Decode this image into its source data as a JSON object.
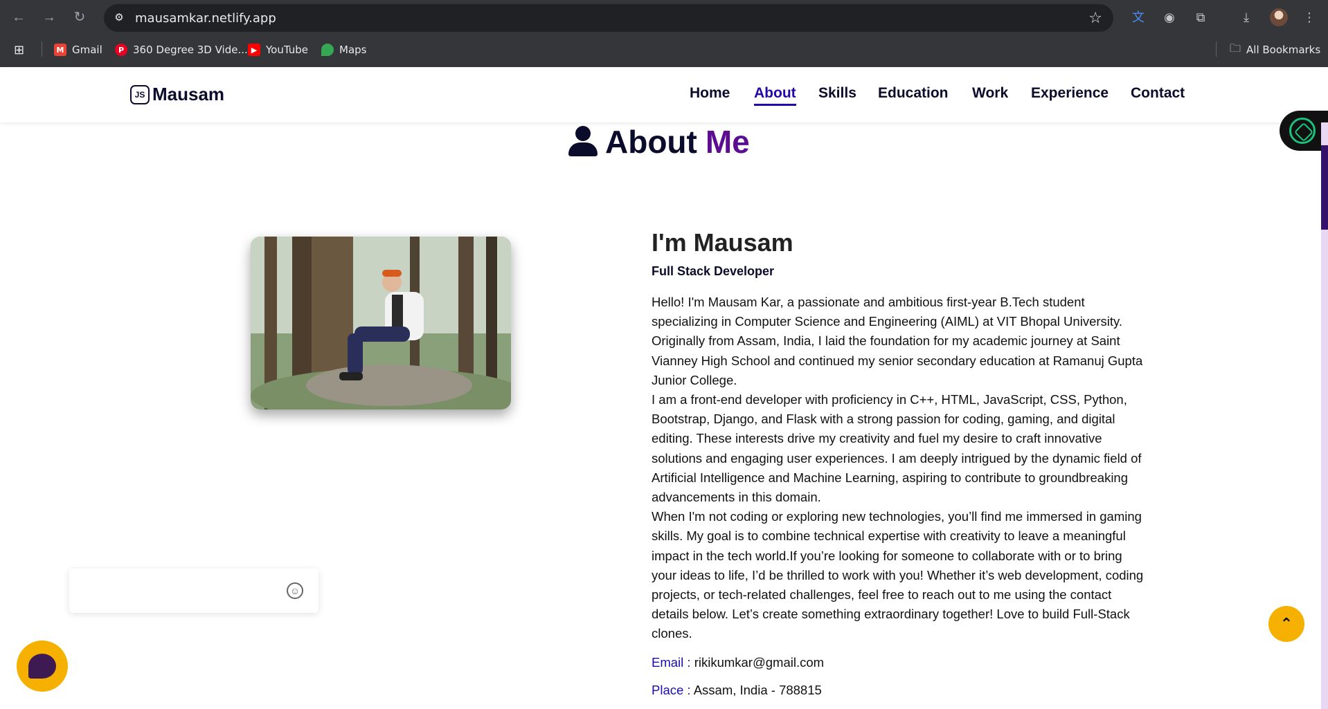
{
  "browser": {
    "url": "mausamkar.netlify.app",
    "bookmarks": [
      {
        "label": "Gmail",
        "icon": "gmail-icon",
        "color": "#ea4335"
      },
      {
        "label": "360 Degree 3D Vide...",
        "icon": "pinterest-icon",
        "color": "#e60023"
      },
      {
        "label": "YouTube",
        "icon": "youtube-icon",
        "color": "#ff0000"
      },
      {
        "label": "Maps",
        "icon": "maps-icon",
        "color": "#34a853"
      }
    ],
    "all_bookmarks": "All Bookmarks"
  },
  "site": {
    "logo": "Mausam",
    "nav": [
      "Home",
      "About",
      "Skills",
      "Education",
      "Work",
      "Experience",
      "Contact"
    ],
    "active_nav": "About"
  },
  "about": {
    "title_a": "About",
    "title_b": "Me",
    "name": "I'm Mausam",
    "role": "Full Stack Developer",
    "paragraph": "Hello! I'm Mausam Kar, a passionate and ambitious first-year B.Tech student specializing in Computer Science and Engineering (AIML) at VIT Bhopal University. Originally from Assam, India, I laid the foundation for my academic journey at Saint Vianney High School and continued my senior secondary education at Ramanuj Gupta Junior College.\nI am a front-end developer with proficiency in C++, HTML, JavaScript, CSS, Python, Bootstrap, Django, and Flask with a strong passion for coding, gaming, and digital editing. These interests drive my creativity and fuel my desire to craft innovative solutions and engaging user experiences. I am deeply intrigued by the dynamic field of Artificial Intelligence and Machine Learning, aspiring to contribute to groundbreaking advancements in this domain.\nWhen I'm not coding or exploring new technologies, you’ll find me immersed in gaming skills. My goal is to combine technical expertise with creativity to leave a meaningful impact in the tech world.If you’re looking for someone to collaborate with or to bring your ideas to life, I’d be thrilled to work with you! Whether it’s web development, coding projects, or tech-related challenges, feel free to reach out to me using the contact details below. Let’s create something extraordinary together! Love to build Full-Stack clones.",
    "email_label": "Email",
    "email": "rikikumkar@gmail.com",
    "place_label": "Place",
    "place": "Assam, India - 788815"
  },
  "colors": {
    "accent": "#2506ad",
    "me": "#5c0e91",
    "button": "#f5b000"
  }
}
